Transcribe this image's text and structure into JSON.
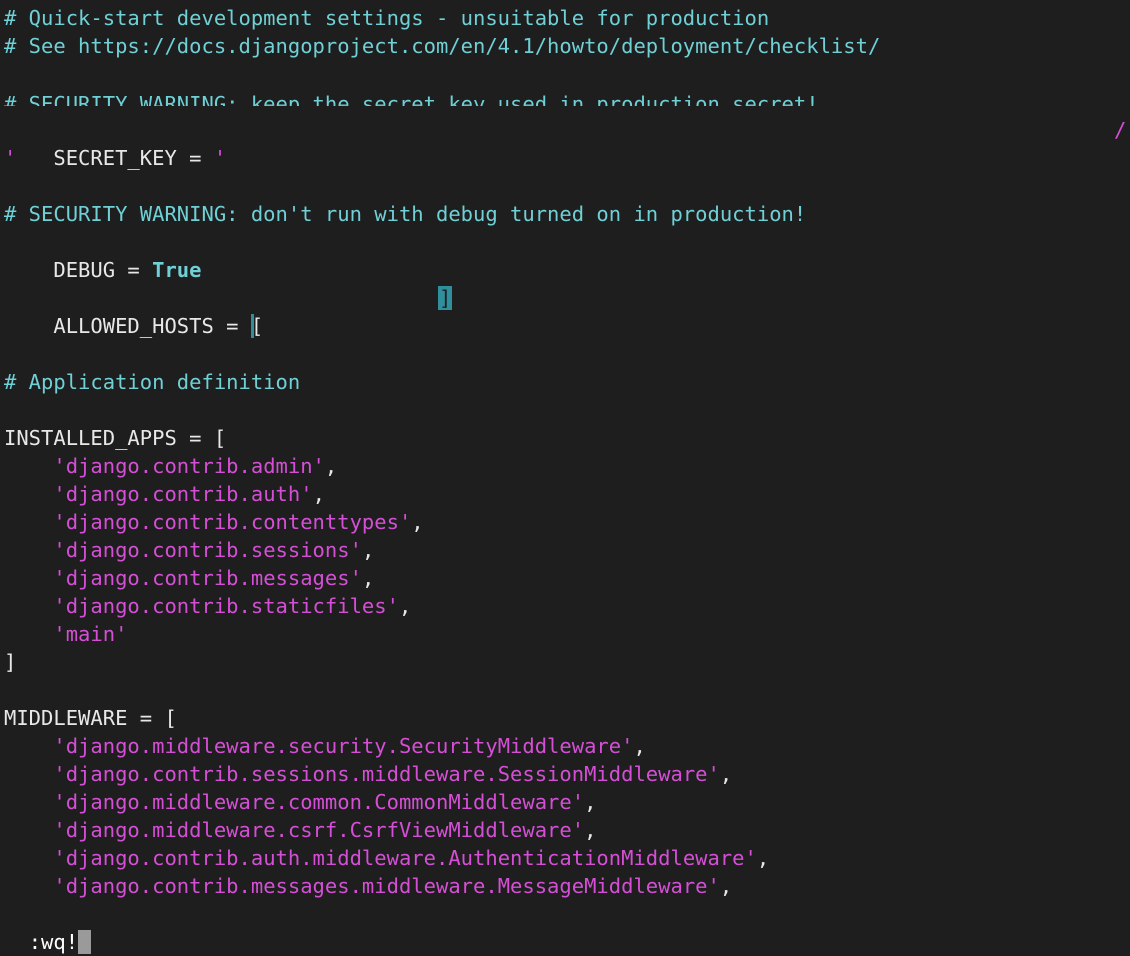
{
  "editor": {
    "comment_quickstart": "# Quick-start development settings - unsuitable for production",
    "comment_see": "# See https://docs.djangoproject.com/en/4.1/howto/deployment/checklist/",
    "comment_secret_warning": "# SECURITY WARNING: keep the secret key used in production secret!",
    "secret_key_prefix": "SECRET_KEY = ",
    "secret_key_open_quote": "'",
    "secret_key_tail_char": "/",
    "secret_key_close_quote": "'",
    "comment_debug_warning": "# SECURITY WARNING: don't run with debug turned on in production!",
    "debug_prefix": "DEBUG = ",
    "debug_value": "True",
    "allowed_hosts_prefix": "ALLOWED_HOSTS = ",
    "allowed_hosts_open": "[",
    "allowed_hosts_close": "]",
    "comment_app_def": "# Application definition",
    "installed_apps_open": "INSTALLED_APPS = [",
    "installed_apps": [
      "'django.contrib.admin'",
      "'django.contrib.auth'",
      "'django.contrib.contenttypes'",
      "'django.contrib.sessions'",
      "'django.contrib.messages'",
      "'django.contrib.staticfiles'",
      "'main'"
    ],
    "installed_apps_close": "]",
    "middleware_open": "MIDDLEWARE = [",
    "middleware": [
      "'django.middleware.security.SecurityMiddleware'",
      "'django.contrib.sessions.middleware.SessionMiddleware'",
      "'django.middleware.common.CommonMiddleware'",
      "'django.middleware.csrf.CsrfViewMiddleware'",
      "'django.contrib.auth.middleware.AuthenticationMiddleware'",
      "'django.contrib.messages.middleware.MessageMiddleware'"
    ]
  },
  "cmdline": {
    "text": ":wq!"
  },
  "colors": {
    "background": "#1e1e1e",
    "comment": "#6fd0d6",
    "string": "#d54fd6",
    "text": "#e8e8e8",
    "bracket_highlight": "#2f8f9c",
    "cursor": "#9a9a9a"
  }
}
